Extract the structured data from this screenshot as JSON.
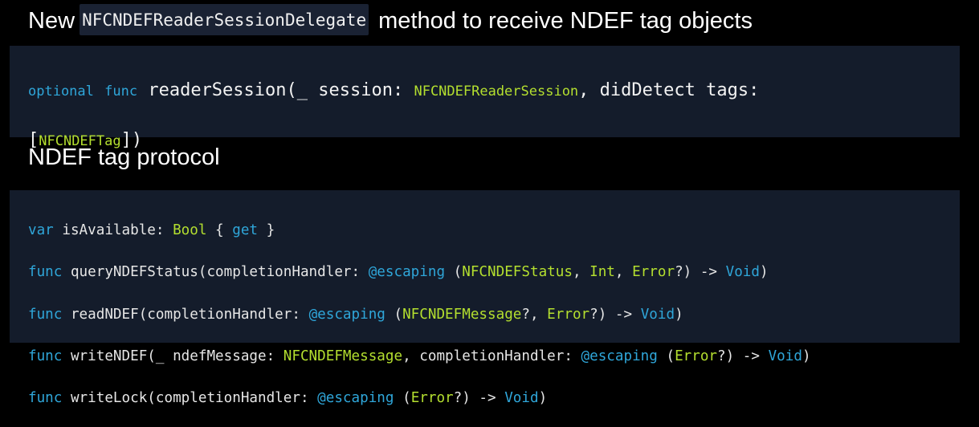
{
  "heading1": {
    "prefix": "New ",
    "code": "NFCNDEFReaderSessionDelegate",
    "suffix": " method to receive NDEF tag objects"
  },
  "code_block_1": {
    "line1": {
      "optional": "optional",
      "func": "func",
      "text1": " readerSession(_ session: ",
      "type1": "NFCNDEFReaderSession",
      "text2": ", didDetect tags:"
    },
    "line2": {
      "open": "[",
      "type": "NFCNDEFTag",
      "close": "])"
    }
  },
  "heading2": "NDEF tag protocol",
  "code_block_2": {
    "line1": {
      "var": "var",
      "t1": " isAvailable: ",
      "bool": "Bool",
      "t2": " { ",
      "get": "get",
      "t3": " }"
    },
    "line2": {
      "func": "func",
      "t1": " queryNDEFStatus(completionHandler: ",
      "escaping": "@escaping",
      "t2": " (",
      "type1": "NFCNDEFStatus",
      "t3": ", ",
      "type2": "Int",
      "t4": ", ",
      "type3": "Error",
      "t5": "?) -> ",
      "void": "Void",
      "t6": ")"
    },
    "line3": {
      "func": "func",
      "t1": " readNDEF(completionHandler: ",
      "escaping": "@escaping",
      "t2": " (",
      "type1": "NFCNDEFMessage",
      "t3": "?, ",
      "type2": "Error",
      "t4": "?) -> ",
      "void": "Void",
      "t5": ")"
    },
    "line4": {
      "func": "func",
      "t1": " writeNDEF(_ ndefMessage: ",
      "type1": "NFCNDEFMessage",
      "t2": ", completionHandler: ",
      "escaping": "@escaping",
      "t3": " (",
      "type2": "Error",
      "t4": "?) -> ",
      "void": "Void",
      "t5": ")"
    },
    "line5": {
      "func": "func",
      "t1": " writeLock(completionHandler: ",
      "escaping": "@escaping",
      "t2": " (",
      "type1": "Error",
      "t3": "?) -> ",
      "void": "Void",
      "t4": ")"
    }
  },
  "colors": {
    "background": "#000000",
    "panel": "#141c2b",
    "keyword": "#2fa6d9",
    "type": "#b4df2f",
    "text": "#f2f2f2"
  }
}
